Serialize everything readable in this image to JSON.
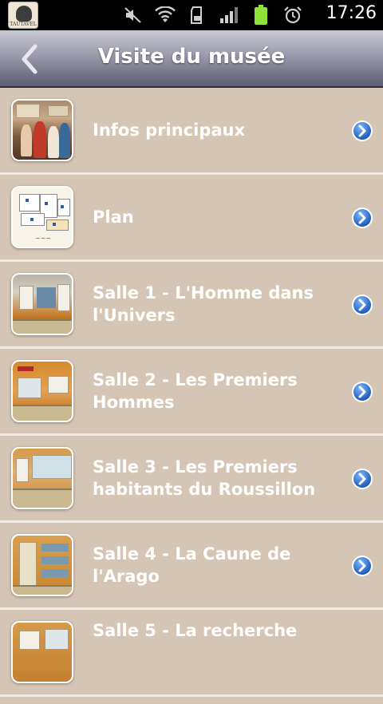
{
  "status_bar": {
    "app_badge_text": "TAUTAVEL",
    "time": "17:26",
    "icons": [
      "mute-icon",
      "wifi-icon",
      "sd-card-icon",
      "signal-icon",
      "battery-icon",
      "alarm-icon"
    ]
  },
  "title_bar": {
    "title": "Visite du musée",
    "back_icon": "chevron-left-icon"
  },
  "list": {
    "items": [
      {
        "label": "Infos principaux",
        "thumb": "thumb-infos"
      },
      {
        "label": "Plan",
        "thumb": "thumb-plan"
      },
      {
        "label": "Salle 1 - L'Homme dans l'Univers",
        "thumb": "thumb-salle1"
      },
      {
        "label": "Salle 2 - Les Premiers Hommes",
        "thumb": "thumb-salle2"
      },
      {
        "label": "Salle 3 - Les Premiers habitants du Roussillon",
        "thumb": "thumb-salle3"
      },
      {
        "label": "Salle 4 - La Caune de l'Arago",
        "thumb": "thumb-salle4"
      },
      {
        "label": "Salle 5 - La recherche",
        "thumb": "thumb-salle5"
      }
    ]
  },
  "colors": {
    "list_background": "#d4c5b4",
    "separator": "#efe9e1",
    "chevron_blue": "#2a6fd0",
    "status_bar": "#000000"
  }
}
